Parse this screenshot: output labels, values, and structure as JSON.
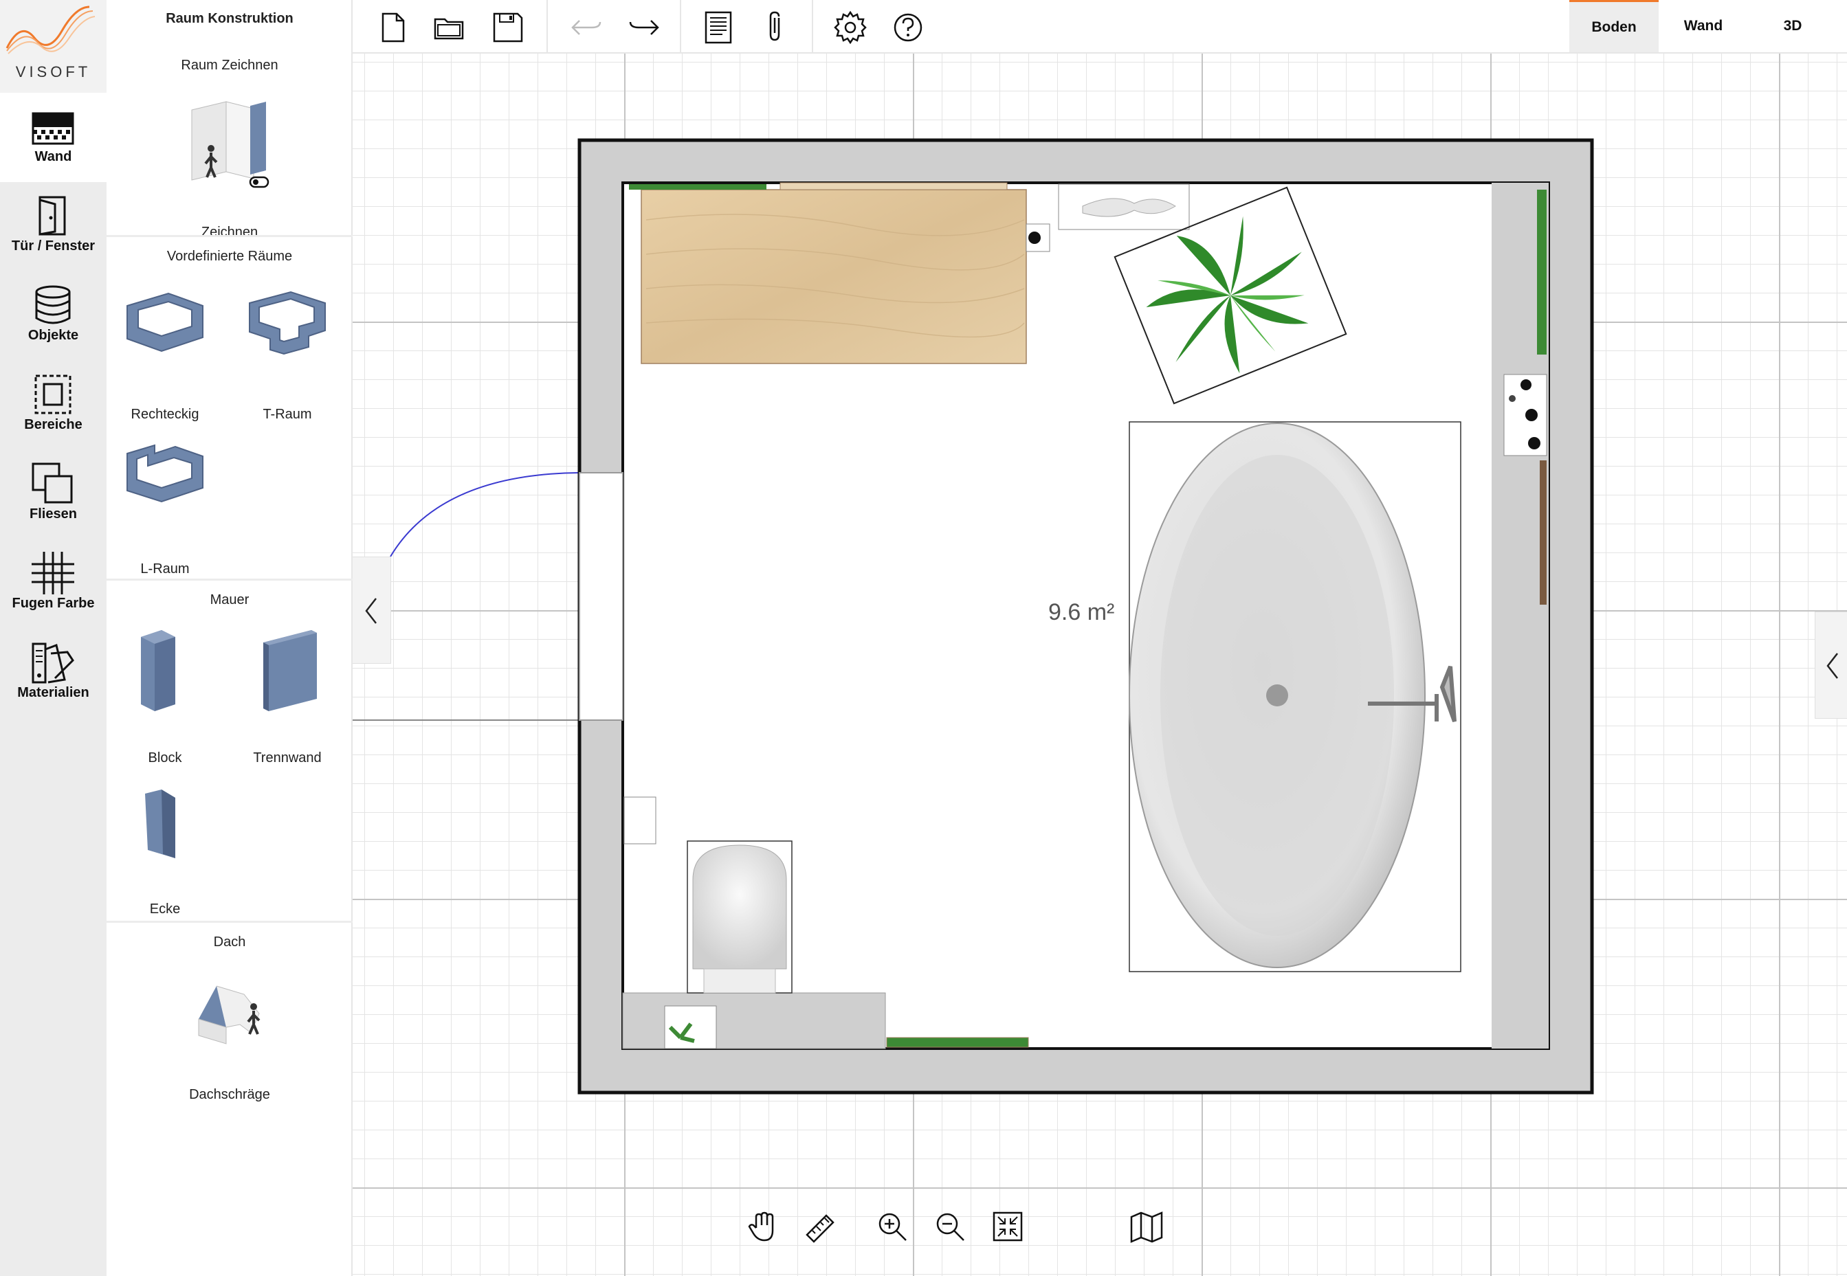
{
  "app": {
    "logo_text": "VISOFT"
  },
  "rail": {
    "items": [
      {
        "label": "Wand",
        "icon": "wall-pattern-icon"
      },
      {
        "label": "Tür / Fenster",
        "icon": "door-icon"
      },
      {
        "label": "Objekte",
        "icon": "database-icon"
      },
      {
        "label": "Bereiche",
        "icon": "area-dashed-icon"
      },
      {
        "label": "Fliesen",
        "icon": "tiles-icon"
      },
      {
        "label": "Fugen Farbe",
        "icon": "grid-lines-icon"
      },
      {
        "label": "Materialien",
        "icon": "swatches-icon"
      }
    ]
  },
  "panel": {
    "title": "Raum Konstruktion",
    "draw_section": {
      "title": "Raum Zeichnen",
      "item": "Zeichnen"
    },
    "predefined_section": {
      "title": "Vordefinierte Räume",
      "items": [
        "Rechteckig",
        "T-Raum",
        "L-Raum"
      ]
    },
    "wall_section": {
      "title": "Mauer",
      "items": [
        "Block",
        "Trennwand",
        "Ecke"
      ]
    },
    "roof_section": {
      "title": "Dach",
      "items": [
        "Dachschräge"
      ]
    }
  },
  "toolbar": {
    "buttons": [
      "new-file-icon",
      "open-folder-icon",
      "save-icon",
      "undo-icon",
      "redo-icon",
      "report-icon",
      "attach-icon",
      "settings-icon",
      "help-icon"
    ],
    "views": [
      "Boden",
      "Wand",
      "3D"
    ],
    "active_view": "Boden",
    "accent_color": "#f07a2c"
  },
  "canvas": {
    "area_label": "9.6 m²"
  },
  "bottom_tools": [
    "pan-hand-icon",
    "ruler-icon",
    "zoom-in-icon",
    "zoom-out-icon",
    "fit-screen-icon",
    "map-icon"
  ]
}
